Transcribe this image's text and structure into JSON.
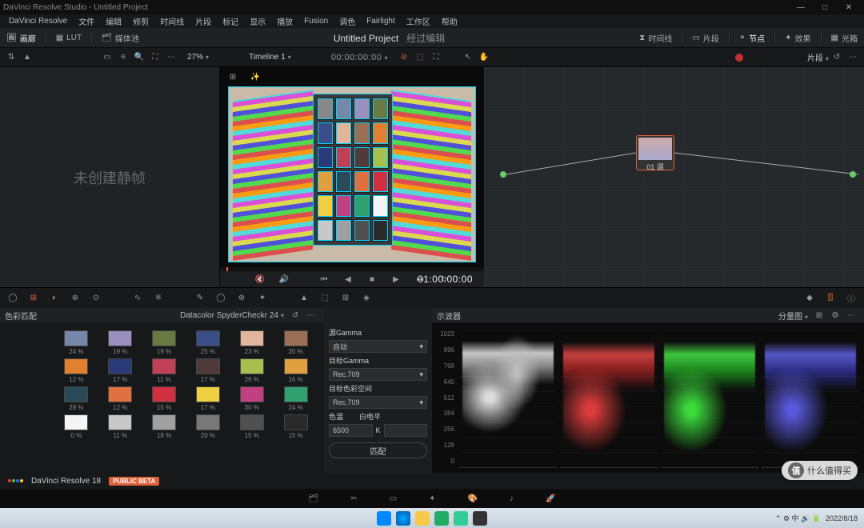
{
  "window": {
    "title": "DaVinci Resolve Studio - Untitled Project"
  },
  "menu": {
    "items": [
      "DaVinci Resolve",
      "文件",
      "编辑",
      "修剪",
      "时间线",
      "片段",
      "标记",
      "显示",
      "播放",
      "Fusion",
      "调色",
      "Fairlight",
      "工作区",
      "帮助"
    ]
  },
  "workspace": {
    "gallery": "画廊",
    "lut": "LUT",
    "mediapool": "媒体池",
    "project": "Untitled Project",
    "history": "经过编辑",
    "timeline_btn": "时间线",
    "clips_btn": "片段",
    "nodes_btn": "节点",
    "fx_btn": "效果",
    "lightbox": "光箱"
  },
  "subtool": {
    "zoom": "27%",
    "timeline": "Timeline 1",
    "src_tc": "00:00:00:00",
    "clip_label": "片段"
  },
  "left_placeholder": "未创建静帧",
  "transport": {
    "rec_tc": "01:00:00:00"
  },
  "node": {
    "label": "01 调"
  },
  "panels": {
    "colormatch": "色彩匹配",
    "chart_name": "Datacolor SpyderCheckr 24",
    "scopes": "示波器",
    "scopes_mode": "分量图"
  },
  "params": {
    "src_gamma_label": "源Gamma",
    "src_gamma": "自动",
    "tgt_gamma_label": "目标Gamma",
    "tgt_gamma": "Rec.709",
    "tgt_cs_label": "目标色彩空间",
    "tgt_cs": "Rec.709",
    "temp_label": "色温",
    "white_label": "白电平",
    "temp_val": "6500",
    "temp_unit": "K",
    "match_btn": "匹配"
  },
  "swatches": [
    {
      "c": "#7588aa",
      "p": "24 %"
    },
    {
      "c": "#9a8fbf",
      "p": "19 %"
    },
    {
      "c": "#6a7a45",
      "p": "19 %"
    },
    {
      "c": "#3a4f8a",
      "p": "25 %"
    },
    {
      "c": "#e0b79c",
      "p": "23 %"
    },
    {
      "c": "#9a6f55",
      "p": "20 %"
    },
    {
      "c": "#e08030",
      "p": "12 %"
    },
    {
      "c": "#2a3a78",
      "p": "17 %"
    },
    {
      "c": "#c04055",
      "p": "11 %"
    },
    {
      "c": "#503a3a",
      "p": "17 %"
    },
    {
      "c": "#a8c050",
      "p": "26 %"
    },
    {
      "c": "#e0a040",
      "p": "16 %"
    },
    {
      "c": "#2a4a5a",
      "p": "28 %"
    },
    {
      "c": "#e07040",
      "p": "12 %"
    },
    {
      "c": "#d03040",
      "p": "15 %"
    },
    {
      "c": "#f0d040",
      "p": "17 %"
    },
    {
      "c": "#c04080",
      "p": "30 %"
    },
    {
      "c": "#30a070",
      "p": "24 %"
    },
    {
      "c": "#f5f5f5",
      "p": "0 %"
    },
    {
      "c": "#c8c8c8",
      "p": "11 %"
    },
    {
      "c": "#a0a0a0",
      "p": "18 %"
    },
    {
      "c": "#787878",
      "p": "20 %"
    },
    {
      "c": "#505050",
      "p": "15 %"
    },
    {
      "c": "#2a2a2a",
      "p": "15 %"
    }
  ],
  "checker_colors": [
    "#888",
    "#7588aa",
    "#9a8fbf",
    "#6a7a45",
    "#3a4f8a",
    "#e0b79c",
    "#9a6f55",
    "#e08030",
    "#2a3a78",
    "#c04055",
    "#503a3a",
    "#a8c050",
    "#e0a040",
    "#2a4a5a",
    "#e07040",
    "#d03040",
    "#f0d040",
    "#c04080",
    "#30a070",
    "#f5f5f5",
    "#c8c8c8",
    "#a0a0a0",
    "#505050",
    "#2a2a2a"
  ],
  "scope_scale": [
    "1023",
    "896",
    "768",
    "640",
    "512",
    "384",
    "256",
    "128",
    "0"
  ],
  "footer": {
    "app": "DaVinci Resolve 18",
    "beta": "PUBLIC BETA"
  },
  "tray": {
    "date": "2022/8/18"
  },
  "watermark": "什么值得买"
}
